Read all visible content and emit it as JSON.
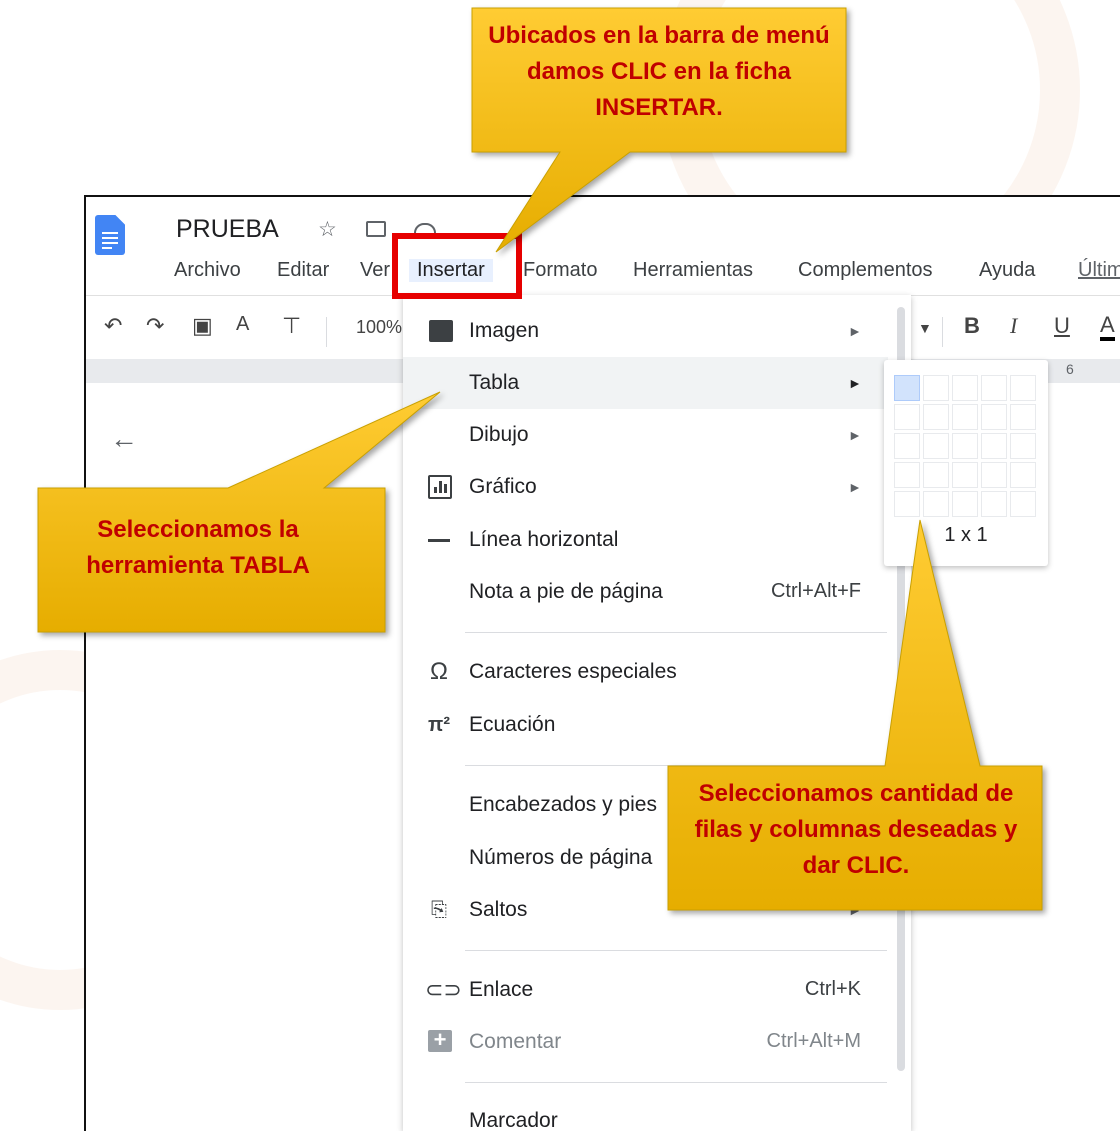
{
  "document": {
    "title": "PRUEBA",
    "star_icon": "☆",
    "move_icon": "folder-move-icon",
    "cloud_icon": "cloud-saved-icon"
  },
  "menubar": {
    "items": [
      "Archivo",
      "Editar",
      "Ver",
      "Insertar",
      "Formato",
      "Herramientas",
      "Complementos",
      "Ayuda",
      "Últim"
    ],
    "active": "Insertar"
  },
  "toolbar": {
    "zoom": "100%",
    "bold": "B",
    "italic": "I",
    "underline": "U",
    "text_color": "A",
    "ruler_marker": "6"
  },
  "insert_menu": {
    "items": [
      {
        "label": "Imagen",
        "icon": "image-icon",
        "submenu": true
      },
      {
        "label": "Tabla",
        "submenu": true
      },
      {
        "label": "Dibujo",
        "submenu": true
      },
      {
        "label": "Gráfico",
        "icon": "chart-icon",
        "submenu": true
      },
      {
        "label": "Línea horizontal",
        "icon": "horizontal-line-icon"
      },
      {
        "label": "Nota a pie de página",
        "shortcut": "Ctrl+Alt+F"
      },
      {
        "label": "Caracteres especiales",
        "icon": "omega-icon",
        "glyph": "Ω"
      },
      {
        "label": "Ecuación",
        "icon": "pi-icon",
        "glyph": "π²"
      },
      {
        "label": "Encabezados y pies"
      },
      {
        "label": "Números de página"
      },
      {
        "label": "Saltos",
        "icon": "page-break-icon",
        "submenu": true
      },
      {
        "label": "Enlace",
        "icon": "link-icon",
        "shortcut": "Ctrl+K"
      },
      {
        "label": "Comentar",
        "icon": "comment-icon",
        "shortcut": "Ctrl+Alt+M",
        "disabled": true
      },
      {
        "label": "Marcador"
      }
    ]
  },
  "table_picker": {
    "rows": 5,
    "cols": 5,
    "selected_rows": 1,
    "selected_cols": 1,
    "size_label": "1 x 1"
  },
  "callouts": {
    "top": "Ubicados en la barra de menú damos CLIC en la ficha INSERTAR.",
    "left": "Seleccionamos la herramienta TABLA",
    "bottom": "Seleccionamos cantidad de filas y columnas deseadas y dar CLIC."
  },
  "colors": {
    "callout_fill": "#ffc000",
    "callout_text": "#c00000",
    "highlight": "#e60000",
    "docs_blue": "#4285f4"
  }
}
